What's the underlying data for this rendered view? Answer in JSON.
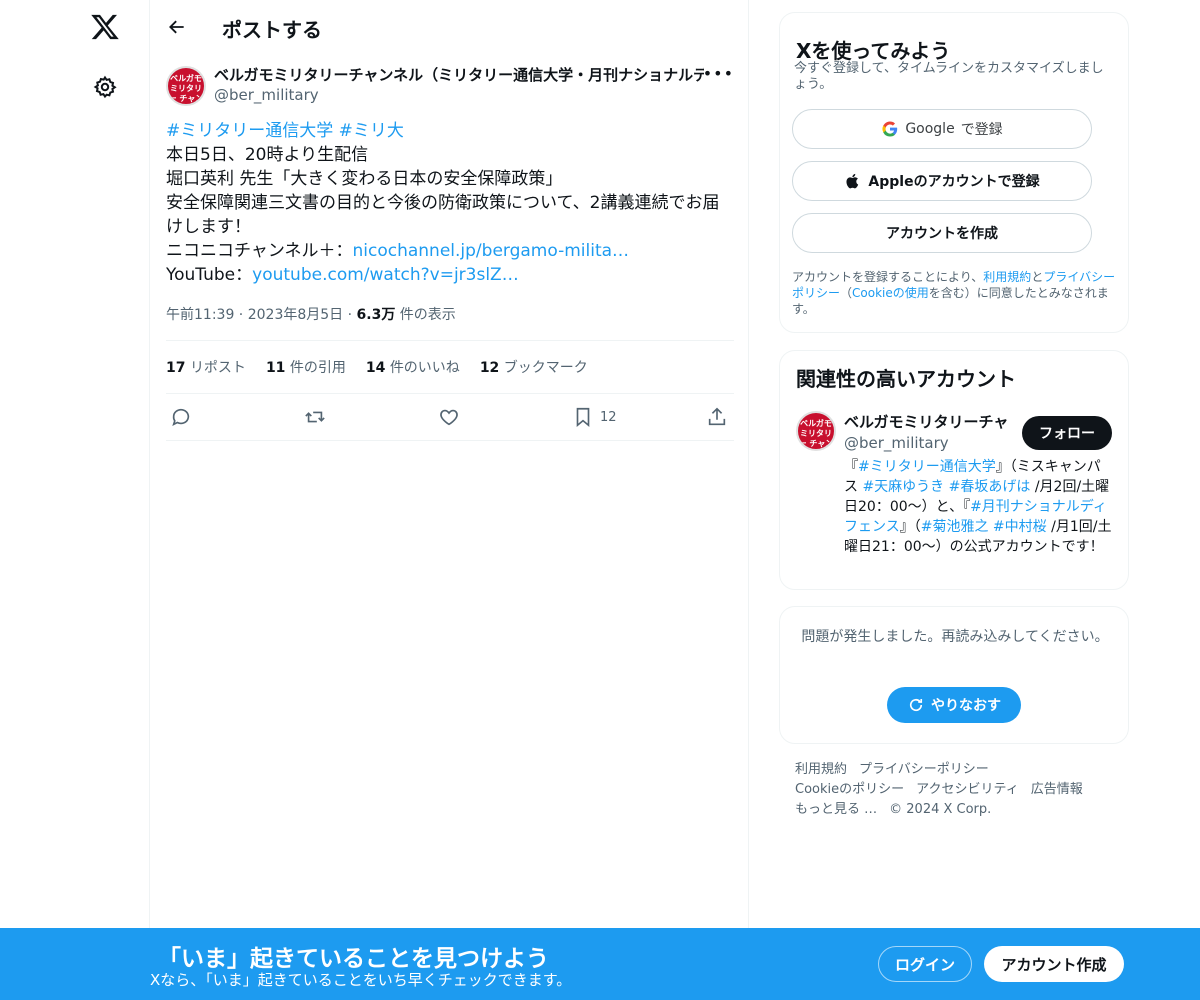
{
  "header": {
    "title": "ポストする"
  },
  "tweet": {
    "author_name": "ベルガモミリタリーチャンネル（ミリタリー通信大学・月刊ナショナルデ",
    "author_handle": "@ber_military",
    "avatar_text": "ベルガモ ミリタリー チャンネル",
    "hashtag1": "#ミリタリー通信大学",
    "hashtag2": "#ミリ大",
    "line1": "本日5日、20時より生配信",
    "line2": "堀口英利 先生「大きく変わる日本の安全保障政策」",
    "line3": "安全保障関連三文書の目的と今後の防衛政策について、2講義連続でお届けします！",
    "niconico_label": "ニコニコチャンネル＋：",
    "niconico_link": "nicochannel.jp/bergamo-milita…",
    "youtube_label": "YouTube：",
    "youtube_link": "youtube.com/watch?v=jr3slZ…",
    "time": "午前11:39",
    "date": "2023年8月5日",
    "views_count": "6.3万",
    "views_label": "件の表示",
    "reposts_count": "17",
    "reposts_label": "リポスト",
    "quotes_count": "11",
    "quotes_label": "件の引用",
    "likes_count": "14",
    "likes_label": "件のいいね",
    "bookmarks_count": "12",
    "bookmarks_label": "ブックマーク",
    "bookmark_action_count": "12"
  },
  "signup_card": {
    "title": "Xを使ってみよう",
    "subtitle": "今すぐ登録して、タイムラインをカスタマイズしましょう。",
    "google_brand": "Google",
    "google_suffix": "で登録",
    "apple_label": "Appleのアカウントで登録",
    "create_label": "アカウントを作成",
    "legal_prefix": "アカウントを登録することにより、",
    "legal_terms": "利用規約",
    "legal_and": "と",
    "legal_privacy": "プライバシーポリシー",
    "legal_mid": "（",
    "legal_cookie": "Cookieの使用",
    "legal_suffix": "を含む）に同意したとみなされます。"
  },
  "related_card": {
    "title": "関連性の高いアカウント",
    "name": "ベルガモミリタリーチャ",
    "handle": "@ber_military",
    "follow_label": "フォロー",
    "bio_1": "『",
    "bio_tag1": "#ミリタリー通信大学",
    "bio_2": "』（ミスキャンパス ",
    "bio_tag2": "#天麻ゆうき",
    "bio_3": " ",
    "bio_tag3": "#春坂あげは",
    "bio_4": " /月2回/土曜日20：00〜）と、『",
    "bio_tag4": "#月刊ナショナルディフェンス",
    "bio_5": "』（",
    "bio_tag5": "#菊池雅之",
    "bio_6": " ",
    "bio_tag6": "#中村桜",
    "bio_7": " /月1回/土曜日21：00〜）の公式アカウントです！"
  },
  "error_card": {
    "message": "問題が発生しました。再読み込みしてください。",
    "retry_label": "やりなおす"
  },
  "footer": {
    "terms": "利用規約",
    "privacy": "プライバシーポリシー",
    "cookie": "Cookieのポリシー",
    "accessibility": "アクセシビリティ",
    "ads": "広告情報",
    "more": "もっと見る …",
    "copyright": "© 2024 X Corp."
  },
  "banner": {
    "title": "「いま」起きていることを見つけよう",
    "subtitle": "Xなら、「いま」起きていることをいち早くチェックできます。",
    "login_label": "ログイン",
    "signup_label": "アカウント作成"
  },
  "colors": {
    "accent": "#1d9bf0",
    "text": "#0f1419",
    "secondary": "#536471",
    "border": "#eff3f4"
  }
}
